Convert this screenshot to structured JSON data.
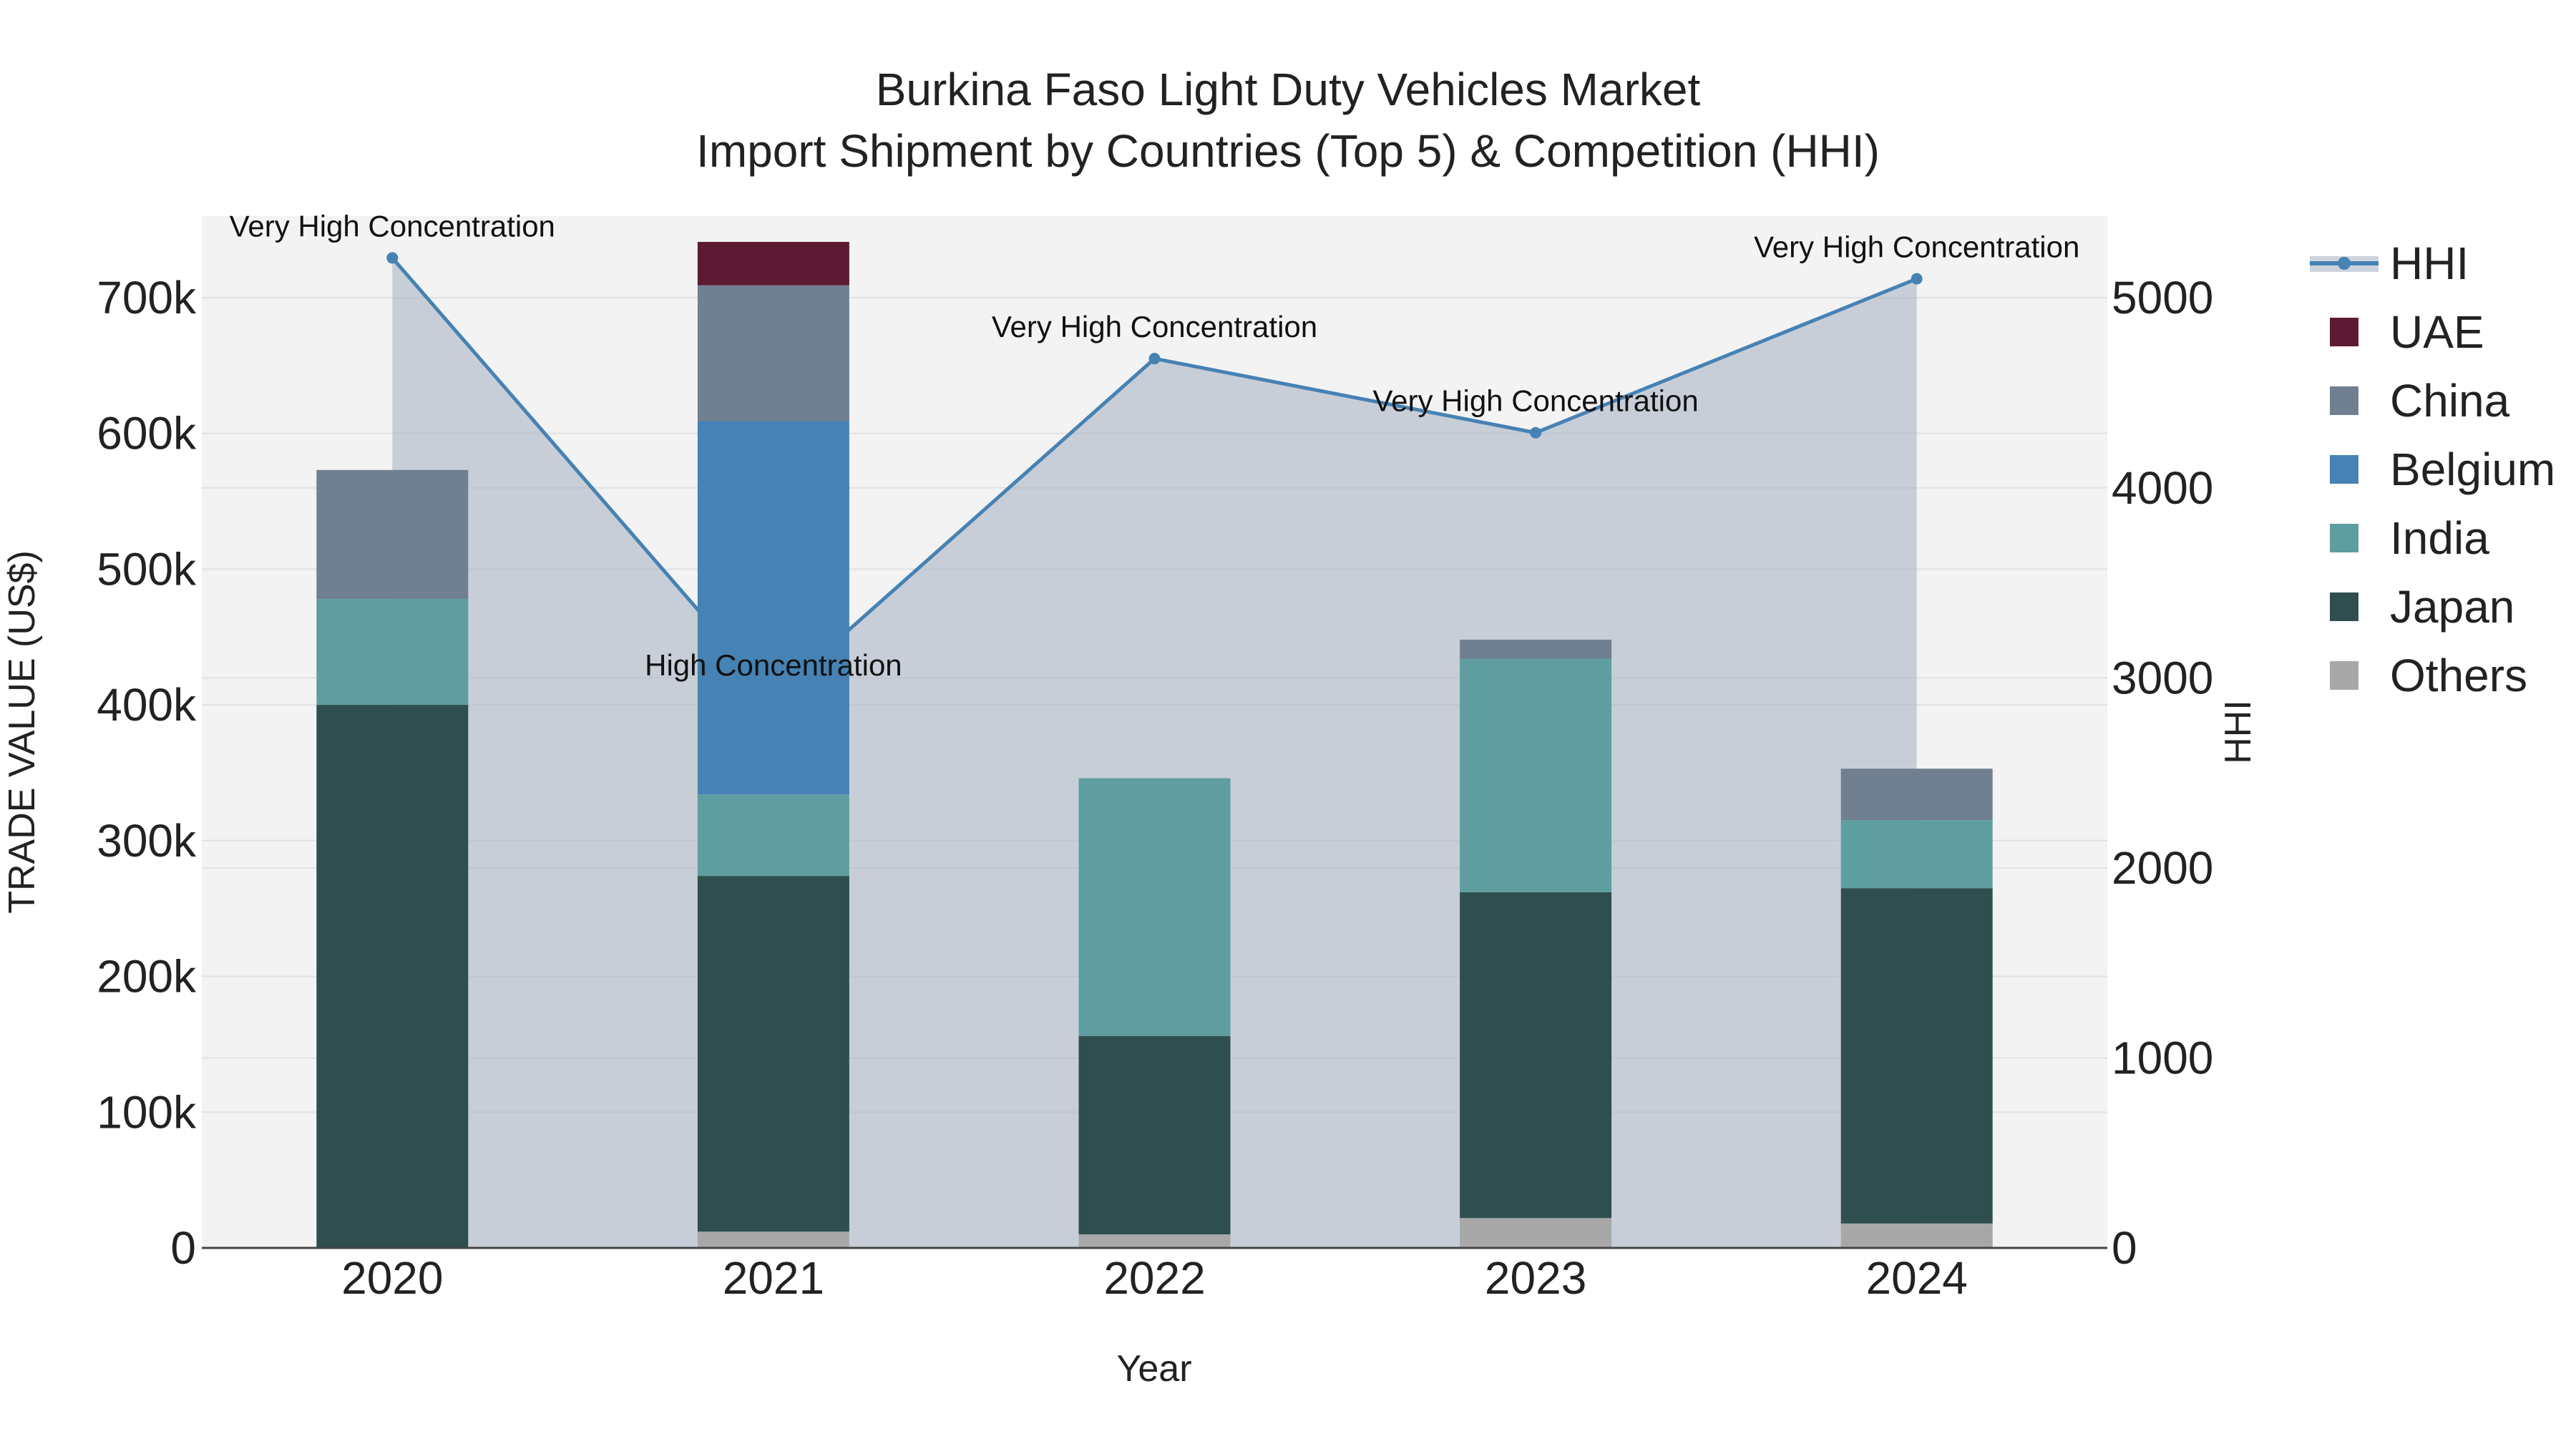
{
  "chart_data": {
    "type": "bar",
    "title": "Burkina Faso Light Duty Vehicles Market",
    "subtitle": "Import Shipment by Countries (Top 5) & Competition (HHI)",
    "xlabel": "Year",
    "ylabel": "TRADE VALUE (US$)",
    "y2label": "HHI",
    "categories": [
      "2020",
      "2021",
      "2022",
      "2023",
      "2024"
    ],
    "ylim": [
      0,
      760000
    ],
    "y2lim": [
      0,
      5430
    ],
    "yticks": [
      "0",
      "100k",
      "200k",
      "300k",
      "400k",
      "500k",
      "600k",
      "700k"
    ],
    "y2ticks": [
      "0",
      "1000",
      "2000",
      "3000",
      "4000",
      "5000"
    ],
    "series": [
      {
        "name": "Others",
        "color": "#a8a8a8",
        "values": [
          0,
          12000,
          10000,
          22000,
          18000
        ]
      },
      {
        "name": "Japan",
        "color": "#2f4f4f",
        "values": [
          400000,
          262000,
          146000,
          240000,
          247000
        ]
      },
      {
        "name": "India",
        "color": "#5f9ea0",
        "values": [
          78000,
          60000,
          190000,
          172000,
          50000
        ]
      },
      {
        "name": "Belgium",
        "color": "#4682b4",
        "values": [
          0,
          275000,
          0,
          0,
          0
        ]
      },
      {
        "name": "China",
        "color": "#708090",
        "values": [
          95000,
          100000,
          0,
          14000,
          38000
        ]
      },
      {
        "name": "UAE",
        "color": "#5c1a33",
        "values": [
          0,
          32000,
          0,
          0,
          0
        ]
      }
    ],
    "hhi": {
      "name": "HHI",
      "color": "#4682b4",
      "values": [
        5210,
        2900,
        4680,
        4290,
        5100
      ],
      "labels": [
        "Very High Concentration",
        "High Concentration",
        "Very High Concentration",
        "Very High Concentration",
        "Very High Concentration"
      ]
    },
    "legend": [
      "HHI",
      "UAE",
      "China",
      "Belgium",
      "India",
      "Japan",
      "Others"
    ],
    "legend_position": "right",
    "grid": true
  }
}
